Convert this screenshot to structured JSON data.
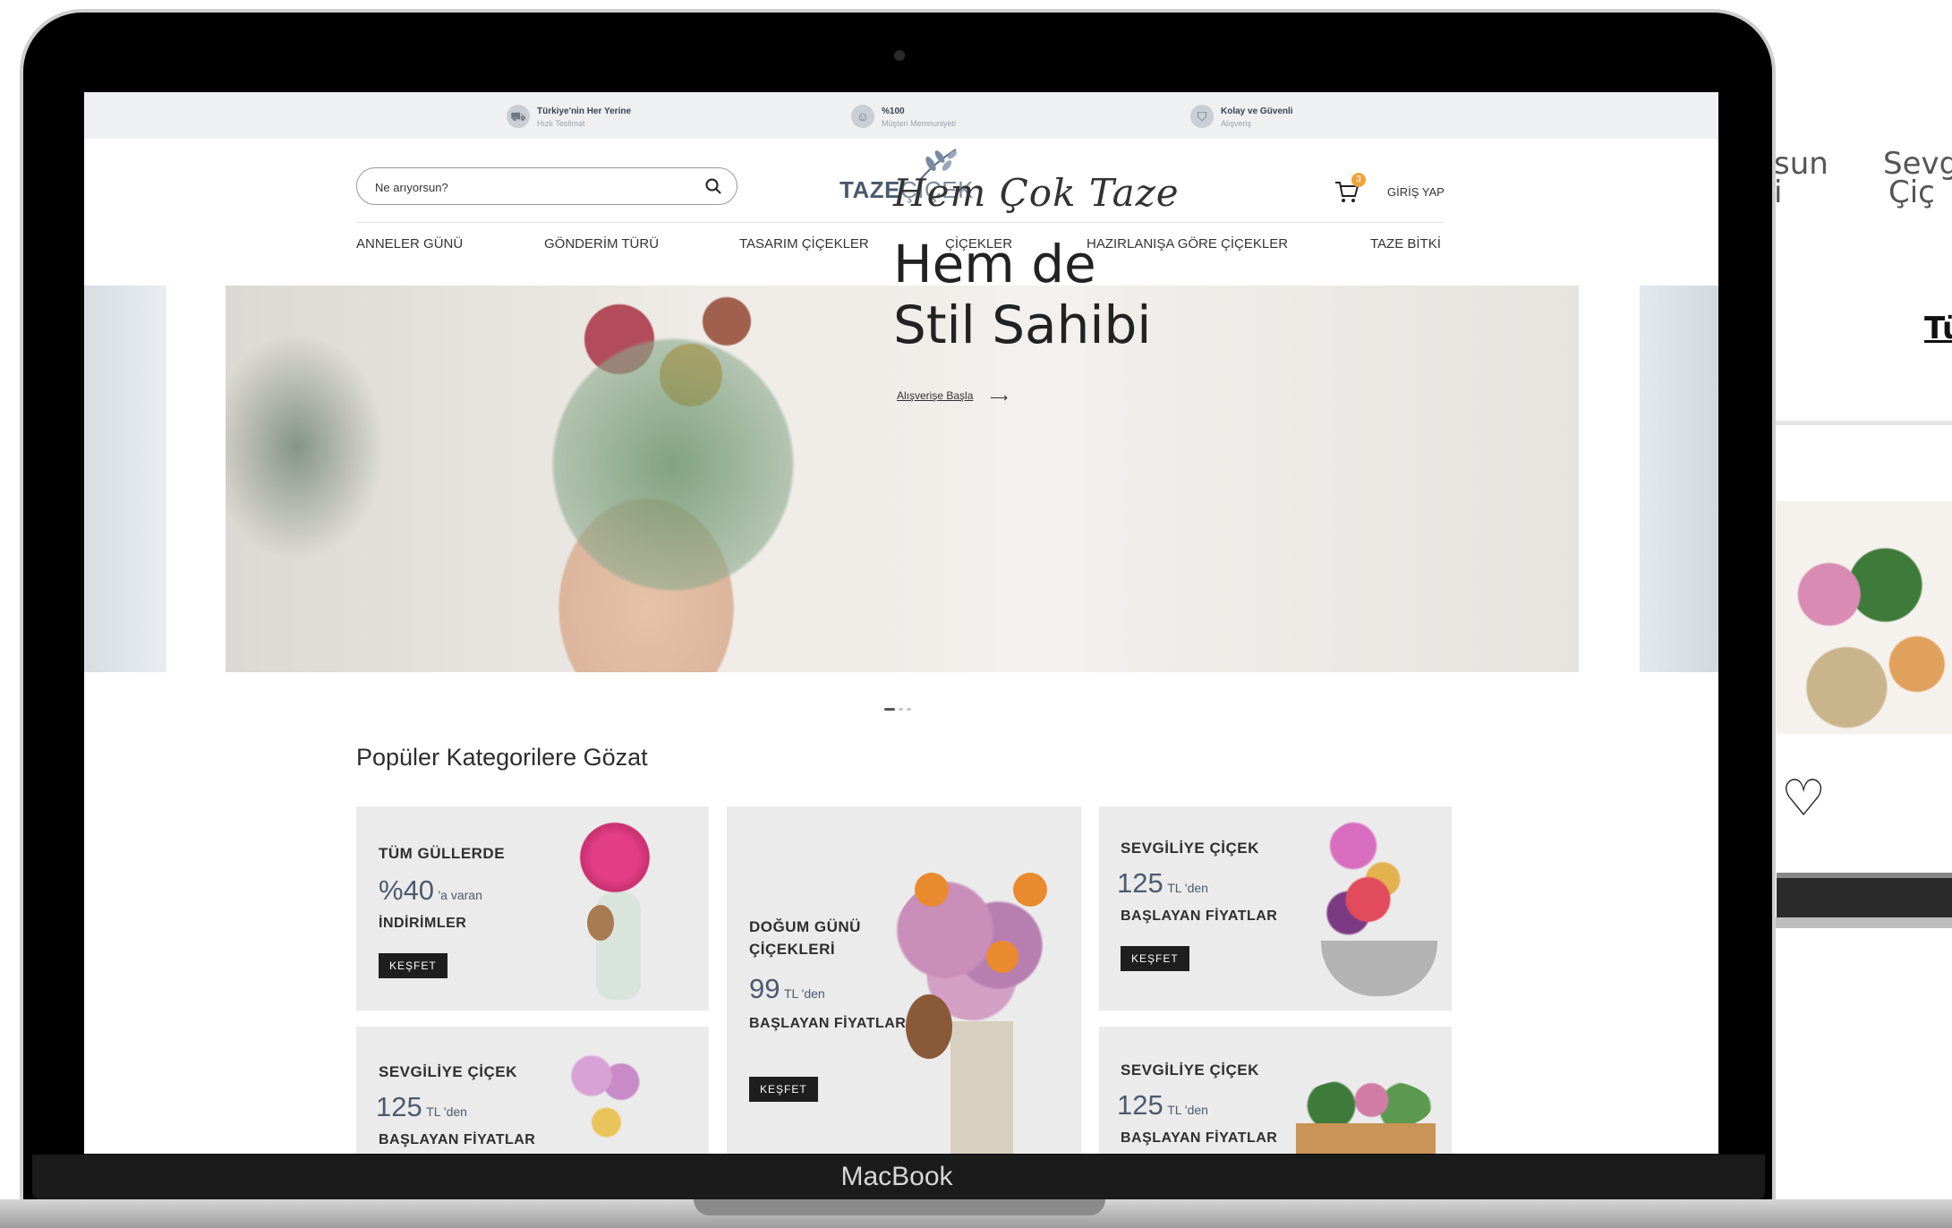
{
  "device": {
    "brand": "MacBook"
  },
  "background": {
    "text_line1": "sun",
    "text_line2": "i",
    "text_right1": "Sevgi",
    "text_right2": "Çiç",
    "text_bold": "Tü",
    "heart_icon": "heart-icon"
  },
  "topbar": {
    "items": [
      {
        "title": "Türkiye'nin Her Yerine",
        "subtitle": "Hızlı Teslimat",
        "icon": "truck-icon"
      },
      {
        "title": "%100",
        "subtitle": "Müşteri Memnuniyeti",
        "icon": "smile-icon"
      },
      {
        "title": "Kolay ve Güvenli",
        "subtitle": "Alışveriş",
        "icon": "shield-icon"
      }
    ]
  },
  "header": {
    "search_placeholder": "Ne arıyorsun?",
    "logo_bold": "TAZE",
    "logo_light": "ÇİÇEK",
    "cart_count": "3",
    "login_label": "GİRİŞ YAP"
  },
  "nav": {
    "items": [
      "ANNELER GÜNÜ",
      "GÖNDERİM TÜRÜ",
      "TASARIM ÇİÇEKLER",
      "ÇİÇEKLER",
      "HAZIRLANIŞA GÖRE ÇİÇEKLER",
      "TAZE BİTKİ"
    ]
  },
  "hero": {
    "script": "Hem Çok Taze",
    "title_line1": "Hem de",
    "title_line2": "Stil Sahibi",
    "link": "Alışverişe Başla",
    "arrow": "⟶"
  },
  "section": {
    "title": "Popüler Kategorilere Gözat"
  },
  "cards": [
    {
      "label1": "TÜM GÜLLERDE",
      "price": "%40",
      "unit": "'a varan",
      "label2": "İNDİRİMLER",
      "button": "KEŞFET"
    },
    {
      "label1": "DOĞUM GÜNÜ",
      "label1b": "ÇİÇEKLERİ",
      "price": "99",
      "unit": "TL 'den",
      "label2": "BAŞLAYAN FİYATLAR",
      "button": "KEŞFET"
    },
    {
      "label1": "SEVGİLİYE ÇİÇEK",
      "price": "125",
      "unit": "TL 'den",
      "label2": "BAŞLAYAN FİYATLAR",
      "button": "KEŞFET"
    },
    {
      "label1": "SEVGİLİYE ÇİÇEK",
      "price": "125",
      "unit": "TL 'den",
      "label2": "BAŞLAYAN FİYATLAR"
    },
    {
      "label1": "SEVGİLİYE ÇİÇEK",
      "price": "125",
      "unit": "TL 'den",
      "label2": "BAŞLAYAN FİYATLAR"
    }
  ],
  "colors": {
    "accent": "#4c5a70",
    "badge": "#f0a33b",
    "button": "#1e1e1e",
    "card_bg": "#ebebeb"
  }
}
